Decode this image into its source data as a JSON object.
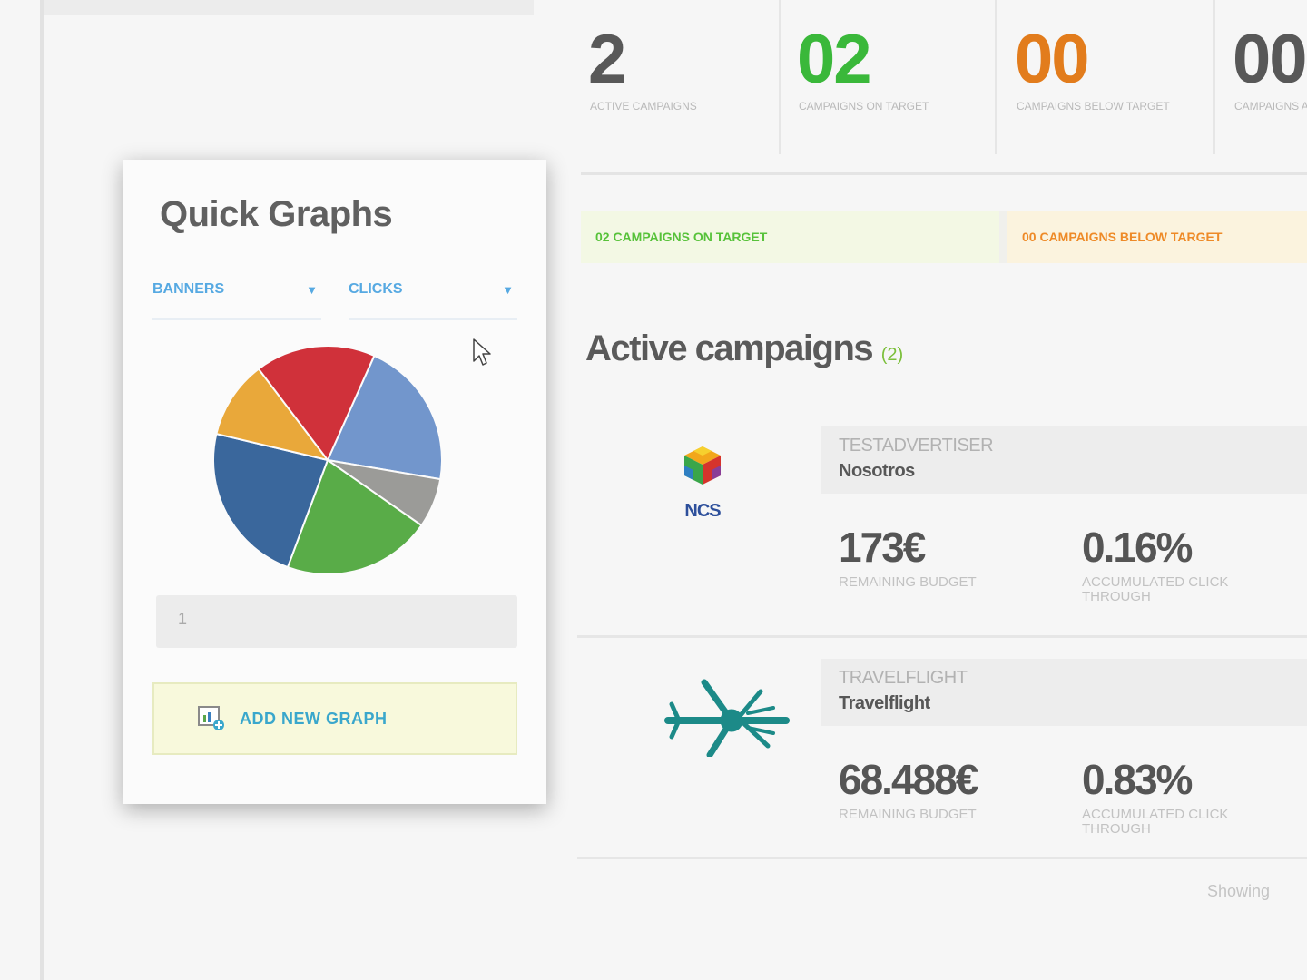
{
  "stats": [
    {
      "value": "2",
      "label": "ACTIVE CAMPAIGNS",
      "color": "#585858"
    },
    {
      "value": "02",
      "label": "CAMPAIGNS ON TARGET",
      "color": "#3ab83a"
    },
    {
      "value": "00",
      "label": "CAMPAIGNS BELOW TARGET",
      "color": "#e27c1c"
    },
    {
      "value": "00",
      "label": "CAMPAIGNS ABOUT TO FINISH",
      "color": "#585858"
    }
  ],
  "targets": {
    "on_target": "02 CAMPAIGNS ON TARGET",
    "below_target": "00 CAMPAIGNS BELOW TARGET"
  },
  "active_campaigns": {
    "title": "Active campaigns",
    "count": "(2)"
  },
  "campaigns": [
    {
      "advertiser_label": "TESTADVERTISER",
      "name": "Nosotros",
      "logo": "ncs-cube-logo",
      "logo_text": "NCS",
      "budget": "173€",
      "budget_label": "REMAINING BUDGET",
      "ctr": "0.16%",
      "ctr_label": "ACCUMULATED CLICK THROUGH"
    },
    {
      "advertiser_label": "TRAVELFLIGHT",
      "name": "Travelflight",
      "logo": "travelflight-plane-logo",
      "budget": "68.488€",
      "budget_label": "REMAINING BUDGET",
      "ctr": "0.83%",
      "ctr_label": "ACCUMULATED CLICK THROUGH"
    }
  ],
  "footer": {
    "showing": "Showing"
  },
  "quick_graphs": {
    "title": "Quick Graphs",
    "select_left": "BANNERS",
    "select_right": "CLICKS",
    "input_value": "1",
    "add_button": "ADD NEW GRAPH",
    "pie_slices": [
      {
        "color": "#7296cc",
        "share": 0.21
      },
      {
        "color": "#9b9b98",
        "share": 0.07
      },
      {
        "color": "#59ac48",
        "share": 0.21
      },
      {
        "color": "#3a679c",
        "share": 0.23
      },
      {
        "color": "#e9a83a",
        "share": 0.11
      },
      {
        "color": "#d0313a",
        "share": 0.17
      }
    ]
  },
  "colors": {
    "accent_blue": "#56a9e2",
    "on_target_green": "#57c23a",
    "below_target_orange": "#ee8a27"
  }
}
